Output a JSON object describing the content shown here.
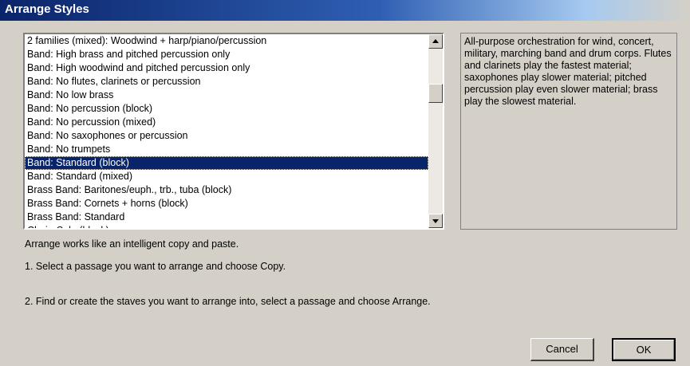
{
  "window": {
    "title": "Arrange Styles"
  },
  "styles_list": {
    "items": [
      "2 families (mixed): Woodwind + harp/piano/percussion",
      "Band: High brass and pitched percussion only",
      "Band: High woodwind and pitched percussion only",
      "Band: No flutes, clarinets or percussion",
      "Band: No low brass",
      "Band: No percussion (block)",
      "Band: No percussion (mixed)",
      "Band: No saxophones or percussion",
      "Band: No trumpets",
      "Band: Standard (block)",
      "Band: Standard (mixed)",
      "Brass Band: Baritones/euph., trb., tuba (block)",
      "Brass Band: Cornets + horns (block)",
      "Brass Band: Standard",
      "Choir: Solo (block)"
    ],
    "selected_index": 9
  },
  "description": {
    "text": "All-purpose orchestration for wind, concert, military, marching band and drum corps. Flutes and clarinets play the fastest material; saxophones play slower material; pitched percussion play even slower material; brass play the slowest material."
  },
  "help": {
    "intro": "Arrange works like an intelligent copy and paste.",
    "step1": "1. Select a passage you want to arrange and choose Copy.",
    "step2": "2. Find or create the staves you want to arrange into, select a passage and choose Arrange."
  },
  "buttons": {
    "cancel": "Cancel",
    "ok": "OK"
  },
  "colors": {
    "selection": "#0a246a",
    "dialog_face": "#d4d0c8"
  }
}
